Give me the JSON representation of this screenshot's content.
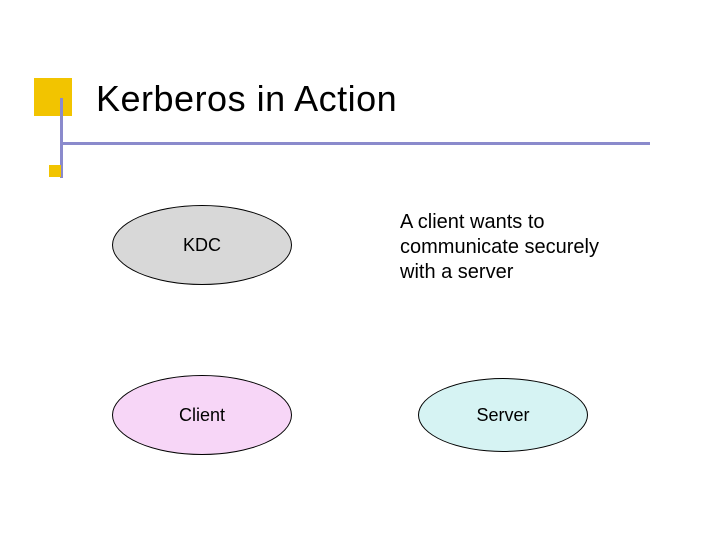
{
  "slide": {
    "title": "Kerberos in Action",
    "caption": "A client wants to communicate securely with a server",
    "nodes": {
      "kdc": "KDC",
      "client": "Client",
      "server": "Server"
    },
    "colors": {
      "accent_square": "#f2c400",
      "line": "#8a8acc",
      "kdc_fill": "#d8d8d8",
      "client_fill": "#f7d6f7",
      "server_fill": "#d6f3f3"
    }
  }
}
